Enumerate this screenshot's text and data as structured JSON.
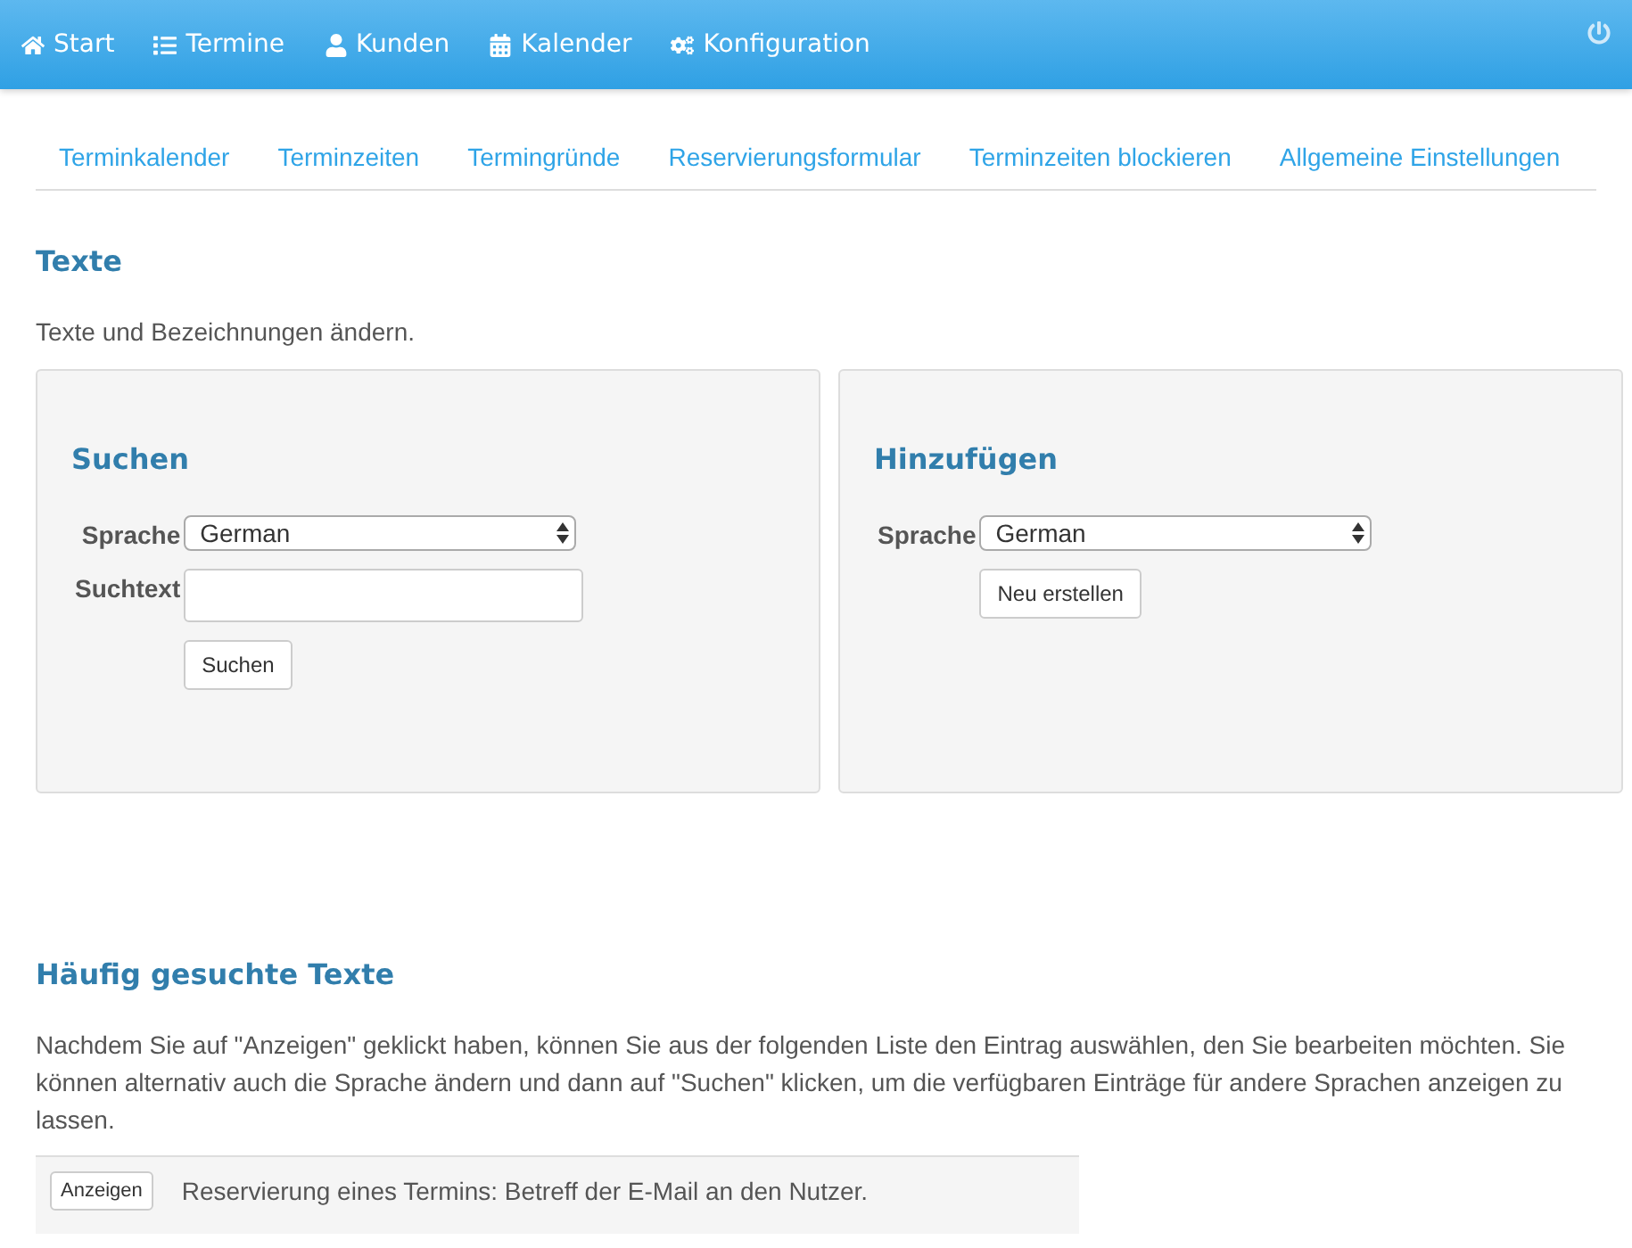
{
  "navbar": {
    "items": [
      {
        "label": "Start",
        "kind": "home"
      },
      {
        "label": "Termine",
        "kind": "list"
      },
      {
        "label": "Kunden",
        "kind": "user"
      },
      {
        "label": "Kalender",
        "kind": "calendar"
      },
      {
        "label": "Konfiguration",
        "kind": "cogs"
      }
    ]
  },
  "subnav": [
    "Terminkalender",
    "Terminzeiten",
    "Termingründe",
    "Reservierungsformular",
    "Terminzeiten blockieren",
    "Allgemeine Einstellungen"
  ],
  "page_title": "Texte",
  "intro": "Texte und Bezeichnungen ändern.",
  "search_panel": {
    "title": "Suchen",
    "language_label": "Sprache",
    "language": "German",
    "text_label": "Suchtext",
    "button": "Suchen"
  },
  "add_panel": {
    "title": "Hinzufügen",
    "language_label": "Sprache",
    "language": "German",
    "button": "Neu erstellen"
  },
  "frequent": {
    "title": "Häufig gesuchte Texte",
    "description": "Nachdem Sie auf \"Anzeigen\" geklickt haben, können Sie aus der folgenden Liste den Eintrag auswählen, den Sie bearbeiten möchten. Sie können alternativ auch die Sprache ändern und dann auf \"Suchen\" klicken, um die verfügbaren Einträge für andere Sprachen anzeigen zu lassen.",
    "rows": [
      {
        "button": "Anzeigen",
        "text": "Reservierung eines Termins: Betreff der E-Mail an den Nutzer."
      }
    ]
  }
}
